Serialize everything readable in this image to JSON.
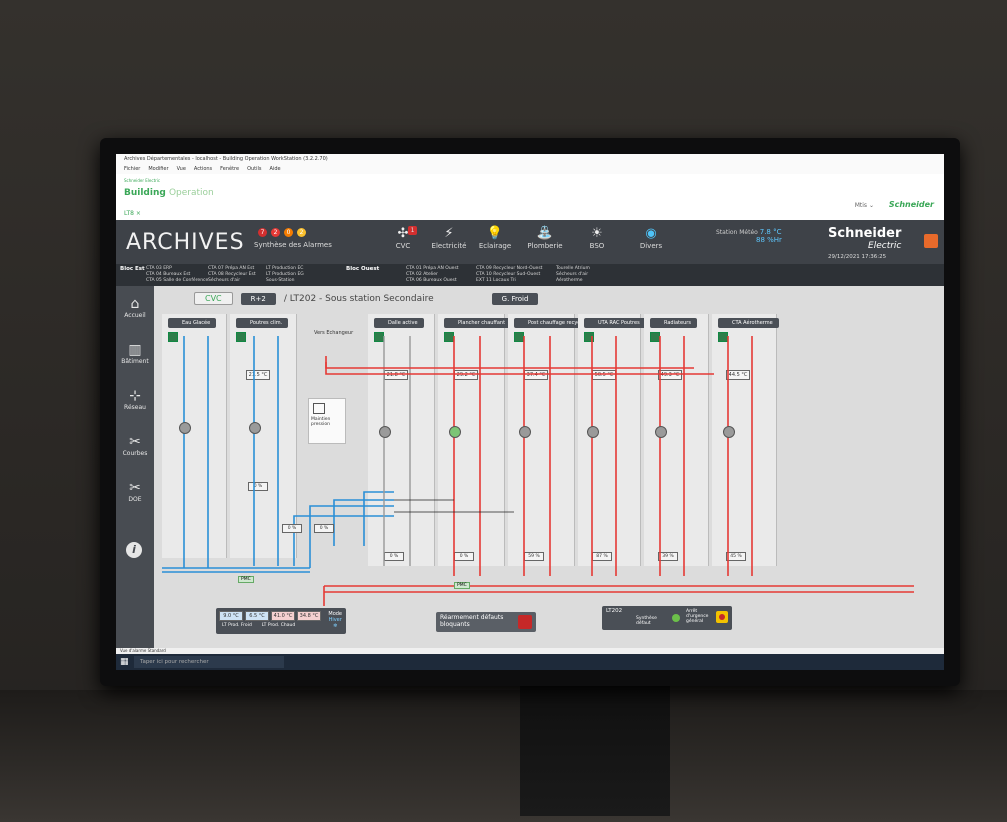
{
  "window": {
    "title": "Archives Départementales - localhost - Building Operation WorkStation (3.2.2.70)",
    "menu": [
      "Fichier",
      "Modifier",
      "Vue",
      "Actions",
      "Fenêtre",
      "Outils",
      "Aide"
    ]
  },
  "header": {
    "brand_top": "Schneider Electric",
    "brand": "Building",
    "brand_light": "Operation",
    "tab": "LT8 ×",
    "user": "Mtis ⌄",
    "logo_small": "Schneider"
  },
  "topbar": {
    "title": "ARCHIVES",
    "alarm_counts": [
      "7",
      "2",
      "0",
      "2"
    ],
    "alarm_colors": [
      "#d32f2f",
      "#e53935",
      "#f57c00",
      "#fbc02d"
    ],
    "alarm_label": "Synthèse des Alarmes",
    "nav": [
      {
        "label": "CVC",
        "icon": "fan-icon",
        "glyph": "✣",
        "badge": "1"
      },
      {
        "label": "Electricité",
        "icon": "lightning-icon",
        "glyph": "⚡",
        "badge": ""
      },
      {
        "label": "Eclairage",
        "icon": "bulb-icon",
        "glyph": "💡",
        "badge": ""
      },
      {
        "label": "Plomberie",
        "icon": "tap-icon",
        "glyph": "⛲",
        "badge": ""
      },
      {
        "label": "BSO",
        "icon": "sun-icon",
        "glyph": "☀",
        "badge": ""
      },
      {
        "label": "Divers",
        "icon": "globe-icon",
        "glyph": "◉",
        "badge": ""
      }
    ],
    "meteo_label": "Station Météo",
    "meteo_temp": "7.8 °C",
    "meteo_hum": "88 %Hr",
    "logo": "Schneider",
    "logo_sub": "Electric",
    "datetime": "29/12/2021 17:36:25"
  },
  "subbar": {
    "zone_est": "Bloc Est",
    "est_col1": [
      "CTA 03 ERP",
      "CTA 04 Bureaux Est",
      "CTA 05 Salle de Conférence"
    ],
    "est_col2": [
      "CTA 07 Prépa AN Est",
      "CTA 08 Recycleur Est",
      "Sécheurs d'air"
    ],
    "est_col3": [
      "LT Production EC",
      "LT Production EG",
      "Sous-Station"
    ],
    "zone_ouest": "Bloc Ouest",
    "ouest_col1": [
      "CTA 01 Prépa AN Ouest",
      "CTA 02 Atelier",
      "CTA 06 Bureaux Ouest"
    ],
    "ouest_col2": [
      "CTA 09 Recycleur Nord-Ouest",
      "CTA 10 Recycleur Sud-Ouest",
      "EXT 11 Locaux Tri"
    ],
    "ouest_col3": [
      "Tourelle Atrium",
      "Sécheurs d'air",
      "Aérotherme"
    ]
  },
  "sidebar": {
    "items": [
      {
        "label": "Accueil",
        "icon": "home-icon",
        "glyph": "⌂"
      },
      {
        "label": "Bâtiment",
        "icon": "building-icon",
        "glyph": "▥"
      },
      {
        "label": "Réseau",
        "icon": "network-icon",
        "glyph": "⊹"
      },
      {
        "label": "Courbes",
        "icon": "tools-icon",
        "glyph": "✂"
      },
      {
        "label": "DOE",
        "icon": "wrench-icon",
        "glyph": "✂"
      }
    ],
    "info": "i"
  },
  "main": {
    "crumb_cvc": "CVC",
    "crumb_level": "R+2",
    "crumb_path": "/ LT202 - Sous station Secondaire",
    "crumb_btn": "G. Froid",
    "panels": [
      {
        "name": "Eau Glacée",
        "temp": "",
        "pct": ""
      },
      {
        "name": "Poutres clim.",
        "temp": "21.5 °C",
        "pct": "0 %"
      },
      {
        "name": "Dalle active",
        "temp": "21.8 °C",
        "pct": "0 %"
      },
      {
        "name": "Plancher chauffant",
        "temp": "29.2 °C",
        "pct": "0 %"
      },
      {
        "name": "Post chauffage recycleur",
        "temp": "37.4 °C",
        "pct": "59 %"
      },
      {
        "name": "UTA RAC Poutres",
        "temp": "50.5 °C",
        "pct": "87 %"
      },
      {
        "name": "Radiateurs",
        "temp": "49.3 °C",
        "pct": "39 %"
      },
      {
        "name": "CTA Aérotherme",
        "temp": "44.5 °C",
        "pct": "45 %"
      }
    ],
    "vers_echangeur": "Vers Echangeur",
    "maintien": "Maintien pression",
    "pct_lower": [
      "0 %",
      "0 %"
    ],
    "pmc": "PMC",
    "lt_temps": [
      "9.0 °C",
      "6.5 °C",
      "41.0 °C",
      "34.8 °C"
    ],
    "lt_prod_froid": "LT Prod. Froid",
    "lt_prod_chaud": "LT Prod. Chaud",
    "mode_label": "Mode",
    "mode_value": "Hiver",
    "rearm_text": "Réarmement défauts bloquants",
    "lt202": "LT202",
    "synthese": "Synthèse défaut",
    "arret": "Arrêt d'urgence général"
  },
  "taskbar": {
    "search_placeholder": "Taper ici pour rechercher",
    "status": "Vue d'alarme Standard"
  }
}
